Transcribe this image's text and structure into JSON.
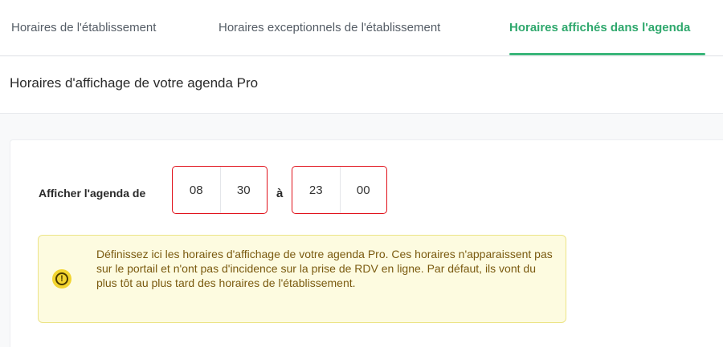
{
  "tabs": [
    {
      "label": "Horaires de l'établissement",
      "active": false
    },
    {
      "label": "Horaires exceptionnels de l'établissement",
      "active": false
    },
    {
      "label": "Horaires affichés dans l'agenda",
      "active": true
    }
  ],
  "page": {
    "title": "Horaires d'affichage de votre agenda Pro"
  },
  "schedule": {
    "label": "Afficher l'agenda de",
    "start": {
      "hours": "08",
      "minutes": "30"
    },
    "separator": "à",
    "end": {
      "hours": "23",
      "minutes": "00"
    }
  },
  "info": {
    "icon": "exclamation-circle-icon",
    "text": "Définissez ici les horaires d'affichage de votre agenda Pro. Ces horaires n'apparaissent pas sur le portail et n'ont pas d'incidence sur la prise de RDV en ligne. Par défaut, ils vont du plus tôt au plus tard des horaires de l'établissement."
  },
  "colors": {
    "accent": "#3bb67a",
    "error_border": "#e0101a",
    "warning_bg": "#fdfbe0",
    "warning_icon": "#f2d430"
  }
}
